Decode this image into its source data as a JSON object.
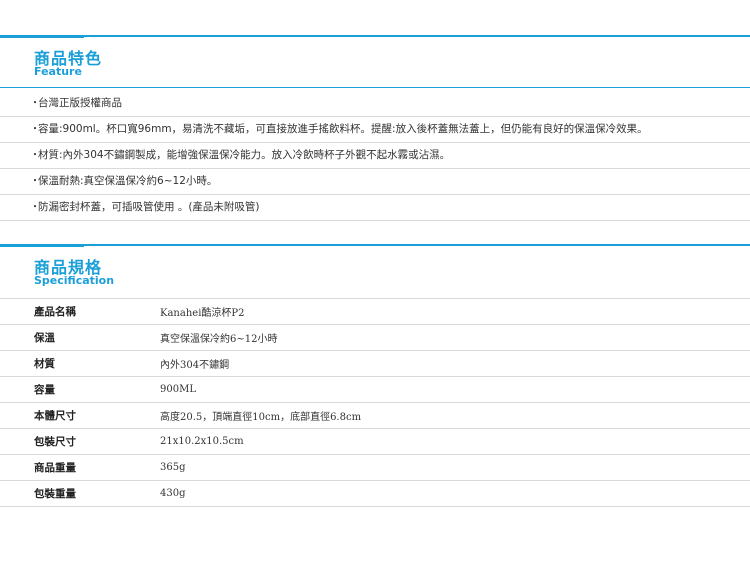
{
  "feature": {
    "title": "商品特色",
    "subtitle": "Feature",
    "items": [
      "台灣正版授權商品",
      "容量:900ml。杯口寬96mm，易清洗不藏垢，可直接放進手搖飲料杯。提醒:放入後杯蓋無法蓋上，但仍能有良好的保溫保冷效果。",
      "材質:內外304不鏽鋼製成，能增強保溫保冷能力。放入冷飲時杯子外觀不起水霧或沾濕。",
      "保溫耐熱:真空保溫保冷約6~12小時。",
      "防漏密封杯蓋，可插吸管使用 。(產品未附吸管)"
    ]
  },
  "spec": {
    "title": "商品規格",
    "subtitle": "Specification",
    "rows": [
      {
        "label": "產品名稱",
        "value": "Kanahei酷涼杯P2"
      },
      {
        "label": "保溫",
        "value": "真空保溫保冷約6~12小時"
      },
      {
        "label": "材質",
        "value": "內外304不鏽鋼"
      },
      {
        "label": "容量",
        "value": "900ML"
      },
      {
        "label": "本體尺寸",
        "value": "高度20.5，頂端直徑10cm，底部直徑6.8cm"
      },
      {
        "label": "包裝尺寸",
        "value": "21x10.2x10.5cm"
      },
      {
        "label": "商品重量",
        "value": "365g"
      },
      {
        "label": "包裝重量",
        "value": "430g"
      }
    ]
  },
  "colors": {
    "accent": "#1b9fd8",
    "rule": "#d9d9d9",
    "text": "#333333"
  }
}
